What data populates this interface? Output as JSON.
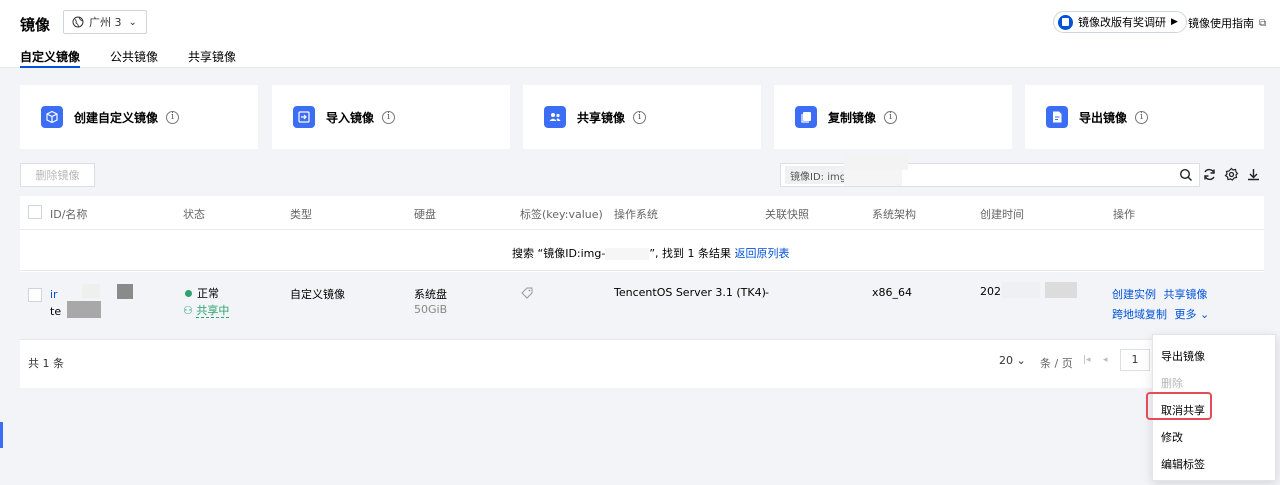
{
  "header": {
    "title": "镜像",
    "region": "广州 3",
    "survey_label": "镜像改版有奖调研",
    "guide_label": "镜像使用指南"
  },
  "tabs": [
    "自定义镜像",
    "公共镜像",
    "共享镜像"
  ],
  "action_cards": [
    {
      "label": "创建自定义镜像",
      "icon": "cube-icon"
    },
    {
      "label": "导入镜像",
      "icon": "import-icon"
    },
    {
      "label": "共享镜像",
      "icon": "users-icon"
    },
    {
      "label": "复制镜像",
      "icon": "copy-icon"
    },
    {
      "label": "导出镜像",
      "icon": "export-icon"
    }
  ],
  "toolbar": {
    "delete_label": "删除镜像",
    "search_tag": "镜像ID: img"
  },
  "table": {
    "columns": [
      "ID/名称",
      "状态",
      "类型",
      "硬盘",
      "标签(key:value)",
      "操作系统",
      "关联快照",
      "系统架构",
      "创建时间",
      "操作"
    ],
    "search_result_prefix": "搜索 “镜像ID:img-",
    "search_result_suffix": "”, 找到 1 条结果",
    "back_link": "返回原列表",
    "row": {
      "id_prefix": "ir",
      "name_prefix": "te",
      "status": "正常",
      "share_status": "共享中",
      "type": "自定义镜像",
      "disk": "系统盘",
      "disk_size": "50GiB",
      "os": "TencentOS Server 3.1 (TK4)",
      "snapshot": "-",
      "arch": "x86_64",
      "created_prefix": "202",
      "actions": [
        "创建实例",
        "共享镜像",
        "跨地域复制",
        "更多"
      ]
    },
    "footer": {
      "total": "共 1 条",
      "page_size": "20",
      "per_page_unit": "条 / 页",
      "page": "1"
    }
  },
  "more_menu": [
    "导出镜像",
    "删除",
    "取消共享",
    "修改",
    "编辑标签"
  ]
}
